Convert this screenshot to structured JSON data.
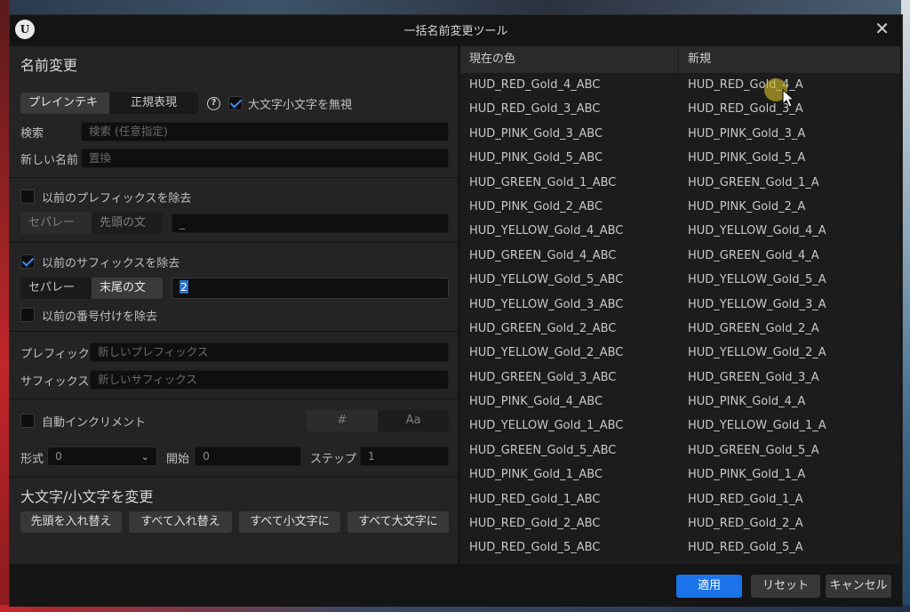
{
  "window": {
    "title": "一括名前変更ツール",
    "logo": "U",
    "close": "✕"
  },
  "rename": {
    "heading": "名前変更",
    "mode_plain": "プレインテキスト",
    "mode_regex": "正規表現",
    "ignore_case_label": "大文字小文字を無視",
    "ignore_case_checked": true,
    "search_label": "検索",
    "search_placeholder": "検索 (任意指定)",
    "new_name_label": "新しい名前",
    "new_name_placeholder": "置換"
  },
  "prefix_remove": {
    "label": "以前のプレフィックスを除去",
    "checked": false,
    "separator": "セパレータ",
    "leading_chars": "先頭の文字",
    "value": "_"
  },
  "suffix_remove": {
    "label": "以前のサフィックスを除去",
    "checked": true,
    "separator": "セパレータ",
    "trailing_chars": "末尾の文字",
    "value": "2",
    "numbering_label": "以前の番号付けを除去",
    "numbering_checked": false
  },
  "add": {
    "prefix_label": "プレフィック.",
    "prefix_placeholder": "新しいプレフィックス",
    "suffix_label": "サフィックス",
    "suffix_placeholder": "新しいサフィックス"
  },
  "auto_increment": {
    "label": "自動インクリメント",
    "checked": false,
    "mode_hash": "#",
    "mode_alpha": "Aa",
    "format_label": "形式",
    "format_value": "0",
    "start_label": "開始",
    "start_value": "0",
    "step_label": "ステップ",
    "step_value": "1"
  },
  "case": {
    "heading": "大文字/小文字を変更",
    "btn_capitalize": "先頭を入れ替え",
    "btn_swap_all": "すべて入れ替え",
    "btn_lower": "すべて小文字に",
    "btn_upper": "すべて大文字に"
  },
  "table": {
    "col_current": "現在の色",
    "col_new": "新規",
    "rows": [
      {
        "current": "HUD_RED_Gold_4_ABC",
        "new": "HUD_RED_Gold_4_A"
      },
      {
        "current": "HUD_RED_Gold_3_ABC",
        "new": "HUD_RED_Gold_3_A"
      },
      {
        "current": "HUD_PINK_Gold_3_ABC",
        "new": "HUD_PINK_Gold_3_A"
      },
      {
        "current": "HUD_PINK_Gold_5_ABC",
        "new": "HUD_PINK_Gold_5_A"
      },
      {
        "current": "HUD_GREEN_Gold_1_ABC",
        "new": "HUD_GREEN_Gold_1_A"
      },
      {
        "current": "HUD_PINK_Gold_2_ABC",
        "new": "HUD_PINK_Gold_2_A"
      },
      {
        "current": "HUD_YELLOW_Gold_4_ABC",
        "new": "HUD_YELLOW_Gold_4_A"
      },
      {
        "current": "HUD_GREEN_Gold_4_ABC",
        "new": "HUD_GREEN_Gold_4_A"
      },
      {
        "current": "HUD_YELLOW_Gold_5_ABC",
        "new": "HUD_YELLOW_Gold_5_A"
      },
      {
        "current": "HUD_YELLOW_Gold_3_ABC",
        "new": "HUD_YELLOW_Gold_3_A"
      },
      {
        "current": "HUD_GREEN_Gold_2_ABC",
        "new": "HUD_GREEN_Gold_2_A"
      },
      {
        "current": "HUD_YELLOW_Gold_2_ABC",
        "new": "HUD_YELLOW_Gold_2_A"
      },
      {
        "current": "HUD_GREEN_Gold_3_ABC",
        "new": "HUD_GREEN_Gold_3_A"
      },
      {
        "current": "HUD_PINK_Gold_4_ABC",
        "new": "HUD_PINK_Gold_4_A"
      },
      {
        "current": "HUD_YELLOW_Gold_1_ABC",
        "new": "HUD_YELLOW_Gold_1_A"
      },
      {
        "current": "HUD_GREEN_Gold_5_ABC",
        "new": "HUD_GREEN_Gold_5_A"
      },
      {
        "current": "HUD_PINK_Gold_1_ABC",
        "new": "HUD_PINK_Gold_1_A"
      },
      {
        "current": "HUD_RED_Gold_1_ABC",
        "new": "HUD_RED_Gold_1_A"
      },
      {
        "current": "HUD_RED_Gold_2_ABC",
        "new": "HUD_RED_Gold_2_A"
      },
      {
        "current": "HUD_RED_Gold_5_ABC",
        "new": "HUD_RED_Gold_5_A"
      }
    ]
  },
  "footer": {
    "apply": "適用",
    "reset": "リセット",
    "cancel": "キャンセル"
  },
  "colors": {
    "accent": "#1a73e8",
    "check": "#3a8ef0",
    "cursor_highlight": "#c8b428"
  }
}
